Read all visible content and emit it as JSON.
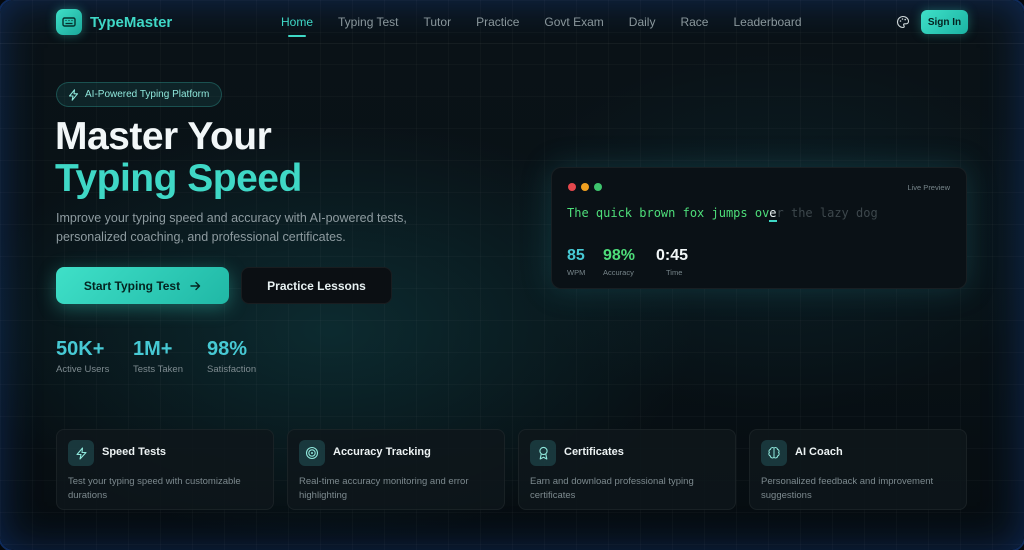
{
  "brand": {
    "name": "TypeMaster"
  },
  "nav": {
    "items": [
      "Home",
      "Typing Test",
      "Tutor",
      "Practice",
      "Govt Exam",
      "Daily",
      "Race",
      "Leaderboard"
    ],
    "active": "Home",
    "signin_label": "Sign In"
  },
  "hero": {
    "badge": "AI-Powered Typing Platform",
    "title_line1": "Master Your",
    "title_line2": "Typing Speed",
    "subtitle": "Improve your typing speed and accuracy with AI-powered tests, personalized coaching, and professional certificates.",
    "primary_cta": "Start Typing Test",
    "secondary_cta": "Practice Lessons",
    "stats": [
      {
        "value": "50K+",
        "label": "Active Users"
      },
      {
        "value": "1M+",
        "label": "Tests Taken"
      },
      {
        "value": "98%",
        "label": "Satisfaction"
      }
    ]
  },
  "preview": {
    "label": "Live Preview",
    "typed": "The quick brown fox jumps ov",
    "current": "e",
    "remaining": "r the lazy dog",
    "stats": [
      {
        "value": "85",
        "label": "WPM",
        "color": "#47c9d4"
      },
      {
        "value": "98%",
        "label": "Accuracy",
        "color": "#4ede7a"
      },
      {
        "value": "0:45",
        "label": "Time",
        "color": "#f2f7f8"
      }
    ]
  },
  "features": [
    {
      "icon": "lightning-icon",
      "title": "Speed Tests",
      "desc": "Test your typing speed with customizable durations"
    },
    {
      "icon": "target-icon",
      "title": "Accuracy Tracking",
      "desc": "Real-time accuracy monitoring and error highlighting"
    },
    {
      "icon": "award-icon",
      "title": "Certificates",
      "desc": "Earn and download professional typing certificates"
    },
    {
      "icon": "brain-icon",
      "title": "AI Coach",
      "desc": "Personalized feedback and improvement suggestions"
    }
  ],
  "colors": {
    "accent": "#3fd8c6",
    "typed": "#4ede7a",
    "background": "#081116"
  }
}
